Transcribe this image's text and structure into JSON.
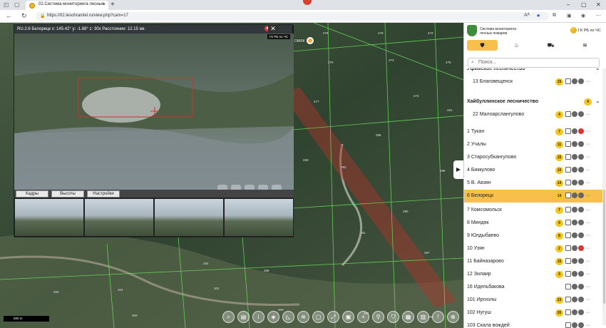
{
  "browser": {
    "tab_title": "02.Система мониторинга лесных",
    "url": "https://02.lesohranitel.ru/view.php?cam=17",
    "read_aloud": "Aᴬ"
  },
  "camera": {
    "title": "RU.2.6 Белорецк x: 145.42° y: -1.88° z: 30x Расстояние: 12.15 км.",
    "tabs": [
      "Кадры",
      "Высоты",
      "Настройки"
    ],
    "gk_label": "ГК РБ по ЧС"
  },
  "map": {
    "location_label": "ОМЯК",
    "scale_label": "500 m",
    "plot_numbers": [
      "278",
      "279",
      "272",
      "270",
      "273",
      "275",
      "277",
      "274",
      "286",
      "281",
      "283",
      "282",
      "299",
      "290",
      "281",
      "284",
      "288",
      "287",
      "300",
      "304",
      "302",
      "300",
      "307",
      "308",
      "309"
    ]
  },
  "sidebar": {
    "brand_line1": "Система мониторинга",
    "brand_line2": "лесных пожаров",
    "user_initial": "Г",
    "user_label": "ГК РБ по ЧС",
    "search_placeholder": "Поиск...",
    "list": [
      {
        "name": "Уфимское лесничество",
        "badge": "",
        "group": true
      },
      {
        "name": "13 Благовещенск",
        "badge": "15",
        "group": false,
        "indent": true
      },
      {
        "name": "Хайбуллинское лесничество",
        "badge": "4",
        "group": true
      },
      {
        "name": "22 Малоарслангулово",
        "badge": "4",
        "group": false,
        "indent": true
      },
      {
        "name": "1 Тукан",
        "badge": "7",
        "group": false
      },
      {
        "name": "2 Учалы",
        "badge": "11",
        "group": false
      },
      {
        "name": "3 Старосубхангулово",
        "badge": "15",
        "group": false
      },
      {
        "name": "4 Биккулово",
        "badge": "10",
        "group": false
      },
      {
        "name": "5 В. Авзян",
        "badge": "14",
        "group": false
      },
      {
        "name": "6 Белорецк",
        "badge": "14",
        "group": false,
        "selected": true
      },
      {
        "name": "7 Комсомольск",
        "badge": "7",
        "group": false
      },
      {
        "name": "8 Миндяк",
        "badge": "9",
        "group": false
      },
      {
        "name": "9 Юлдыбаево",
        "badge": "8",
        "group": false
      },
      {
        "name": "10 Узян",
        "badge": "2",
        "group": false
      },
      {
        "name": "11 Байназарово",
        "badge": "15",
        "group": false
      },
      {
        "name": "12 Зилаир",
        "badge": "9",
        "group": false
      },
      {
        "name": "16 Идельбакова",
        "badge": "",
        "group": false
      },
      {
        "name": "101 Иргизлы",
        "badge": "23",
        "group": false
      },
      {
        "name": "102 Нугуш",
        "badge": "20",
        "group": false
      },
      {
        "name": "103 Скала вождей",
        "badge": "",
        "group": false
      }
    ]
  }
}
